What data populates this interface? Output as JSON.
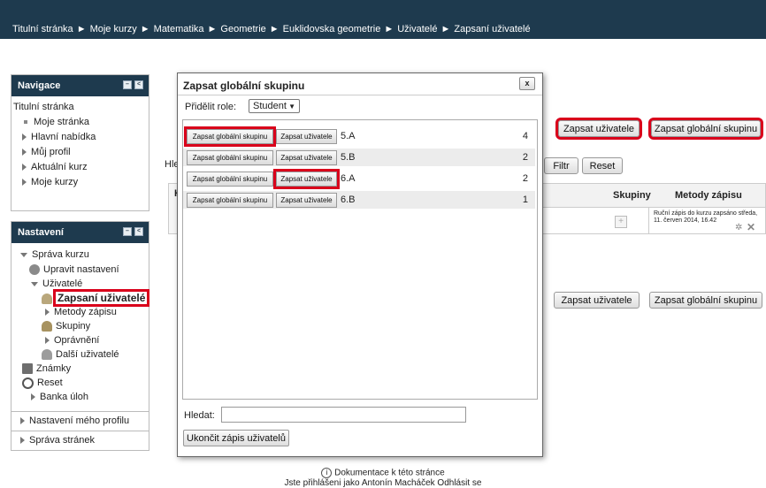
{
  "breadcrumb": [
    "Titulní stránka",
    "Moje kurzy",
    "Matematika",
    "Geometrie",
    "Euklidovska geometrie",
    "Uživatelé",
    "Zapsaní uživatelé"
  ],
  "breadcrumb_separator": "►",
  "navigation": {
    "title": "Navigace",
    "items": [
      "Titulní stránka",
      "Moje stránka",
      "Hlavní nabídka",
      "Můj profil",
      "Aktuální kurz",
      "Moje kurzy"
    ]
  },
  "settings": {
    "title": "Nastavení",
    "course_admin": "Správa kurzu",
    "edit_settings": "Upravit nastavení",
    "users": "Uživatelé",
    "enrolled_users": "Zapsaní uživatelé",
    "enrol_methods": "Metody zápisu",
    "groups": "Skupiny",
    "permissions": "Oprávnění",
    "other_users": "Další uživatelé",
    "grades": "Známky",
    "reset": "Reset",
    "question_bank": "Banka úloh",
    "profile_settings": "Nastavení mého profilu",
    "site_admin": "Správa stránek"
  },
  "main": {
    "search_label_partial": "Hle",
    "col_partial": "K",
    "enrol_users_btn": "Zapsat uživatele",
    "enrol_cohort_btn": "Zapsat globální skupinu",
    "filter_btn": "Filtr",
    "reset_btn": "Reset",
    "col_groups": "Skupiny",
    "col_methods": "Metody zápisu",
    "method_text": "Ruční zápis do kurzu zapsáno středa, 11. červen 2014, 16.42",
    "enrol_users_btn2": "Zapsat uživatele",
    "enrol_cohort_btn2": "Zapsat globální skupinu"
  },
  "dialog": {
    "title": "Zapsat globální skupinu",
    "close": "x",
    "role_label": "Přidělit role:",
    "role_value": "Student",
    "row_btn_cohort": "Zapsat globální skupinu",
    "row_btn_users": "Zapsat uživatele",
    "rows": [
      {
        "name": "5.A",
        "count": "4"
      },
      {
        "name": "5.B",
        "count": "2"
      },
      {
        "name": "6.A",
        "count": "2"
      },
      {
        "name": "6.B",
        "count": "1"
      }
    ],
    "search_label": "Hledat:",
    "finish_btn": "Ukončit zápis uživatelů"
  },
  "footer": {
    "docs": "Dokumentace k této stránce",
    "login_prefix": "Jste přihlášeni jako",
    "user": "Antonín Macháček",
    "logout": "Odhlásit se"
  }
}
